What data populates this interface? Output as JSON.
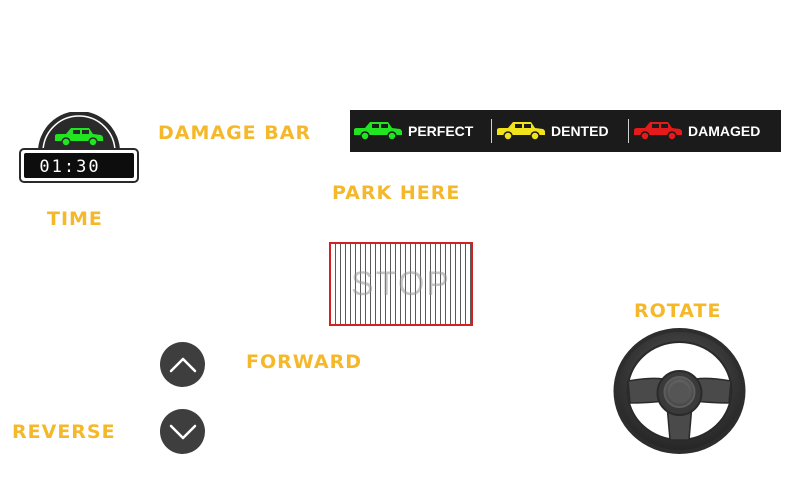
{
  "timer": {
    "value": "01:30",
    "label": "TIME"
  },
  "labels": {
    "damage_bar": "DAMAGE BAR",
    "park_here": "PARK HERE",
    "forward": "FORWARD",
    "reverse": "REVERSE",
    "rotate": "ROTATE"
  },
  "damage_bar": {
    "states": [
      {
        "label": "PERFECT",
        "color": "#22e522"
      },
      {
        "label": "DENTED",
        "color": "#f2e21a"
      },
      {
        "label": "DAMAGED",
        "color": "#e51b1b"
      }
    ]
  },
  "parking_spot": {
    "text": "STOP",
    "border_color": "#d62020"
  },
  "colors": {
    "label": "#f5b82a",
    "bar_bg": "#1b1b1b",
    "button": "#3e3e3e"
  },
  "icons": {
    "timer_car": "car-icon",
    "forward": "chevron-up-icon",
    "reverse": "chevron-down-icon",
    "wheel": "steering-wheel-icon"
  }
}
